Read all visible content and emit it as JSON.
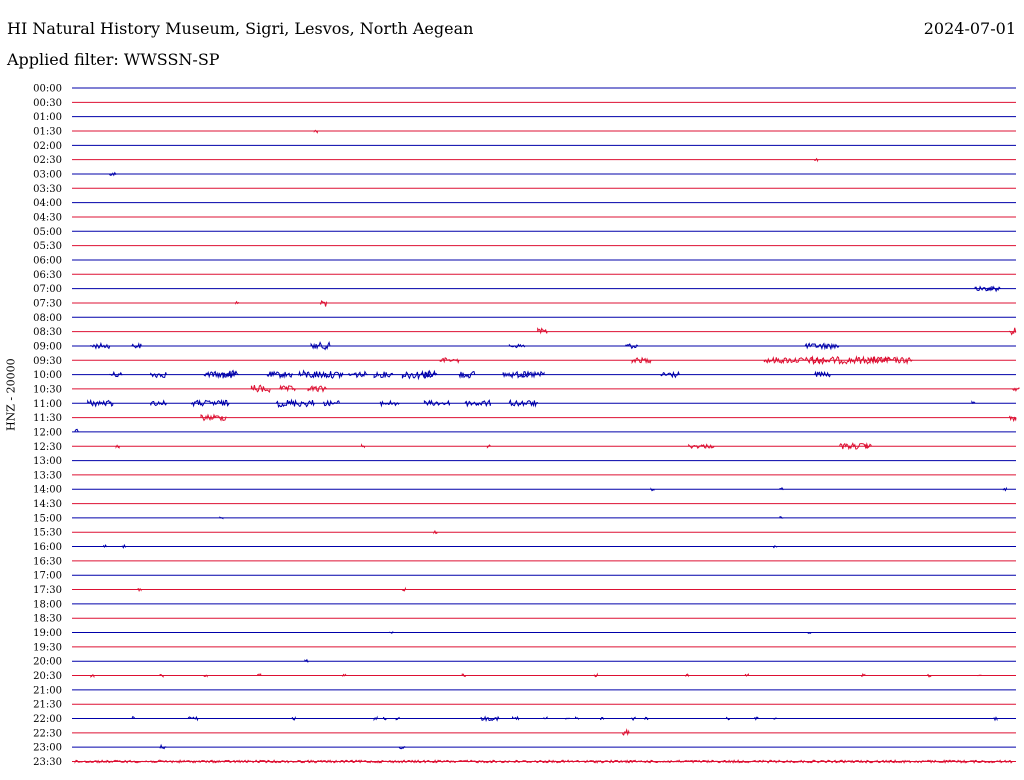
{
  "header": {
    "station": "HI Natural History Museum, Sigri, Lesvos, North Aegean",
    "date": "2024-07-01",
    "filter": "Applied filter: WWSSN-SP"
  },
  "chart_data": {
    "type": "line",
    "ylabel": "HNZ - 20000",
    "colors": {
      "even_trace": "#0000aa",
      "odd_trace": "#dd1133",
      "text": "#000000"
    },
    "tick_labels": [
      "00:00",
      "00:30",
      "01:00",
      "01:30",
      "02:00",
      "02:30",
      "03:00",
      "03:30",
      "04:00",
      "04:30",
      "05:00",
      "05:30",
      "06:00",
      "06:30",
      "07:00",
      "07:30",
      "08:00",
      "08:30",
      "09:00",
      "09:30",
      "10:00",
      "10:30",
      "11:00",
      "11:30",
      "12:00",
      "12:30",
      "13:00",
      "13:30",
      "14:00",
      "14:30",
      "15:00",
      "15:30",
      "16:00",
      "16:30",
      "17:00",
      "17:30",
      "18:00",
      "18:30",
      "19:00",
      "19:30",
      "20:00",
      "20:30",
      "21:00",
      "21:30",
      "22:00",
      "22:30",
      "23:00",
      "23:30"
    ],
    "x_range_minutes": [
      0,
      30
    ],
    "activity": [
      {
        "row": 1,
        "bursts": []
      },
      {
        "row": 3,
        "bursts": [
          [
            7.7,
            0.1,
            0.3
          ]
        ]
      },
      {
        "row": 5,
        "bursts": [
          [
            23.6,
            0.1,
            0.3
          ]
        ]
      },
      {
        "row": 6,
        "bursts": [
          [
            1.2,
            0.2,
            0.4
          ]
        ]
      },
      {
        "row": 14,
        "bursts": [
          [
            28.7,
            0.8,
            0.5
          ],
          [
            29.1,
            0.2,
            0.4
          ]
        ]
      },
      {
        "row": 15,
        "bursts": [
          [
            5.2,
            0.1,
            0.3
          ],
          [
            7.9,
            0.2,
            0.8
          ]
        ]
      },
      {
        "row": 17,
        "bursts": [
          [
            14.8,
            0.3,
            0.6
          ],
          [
            29.8,
            0.2,
            0.8
          ]
        ]
      },
      {
        "row": 18,
        "bursts": [
          [
            0.6,
            0.6,
            0.5
          ],
          [
            1.9,
            0.3,
            0.5
          ],
          [
            7.6,
            0.6,
            0.7
          ],
          [
            13.9,
            0.5,
            0.4
          ],
          [
            17.6,
            0.4,
            0.5
          ],
          [
            23.3,
            0.5,
            0.5
          ],
          [
            23.8,
            0.6,
            0.6
          ]
        ]
      },
      {
        "row": 19,
        "bursts": [
          [
            11.7,
            0.6,
            0.5
          ],
          [
            17.8,
            0.6,
            0.5
          ],
          [
            22.0,
            2.0,
            0.6
          ],
          [
            23.5,
            2.5,
            0.7
          ],
          [
            25.3,
            1.4,
            0.6
          ]
        ]
      },
      {
        "row": 20,
        "bursts": [
          [
            1.2,
            0.4,
            0.5
          ],
          [
            2.5,
            0.5,
            0.6
          ],
          [
            4.2,
            0.6,
            0.6
          ],
          [
            4.8,
            0.4,
            0.5
          ],
          [
            4.9,
            0.1,
            0.4
          ],
          [
            4.8,
            0.5,
            0.8
          ],
          [
            6.2,
            0.8,
            0.6
          ],
          [
            7.2,
            0.7,
            0.8
          ],
          [
            7.9,
            0.7,
            0.7
          ],
          [
            8.8,
            0.6,
            0.6
          ],
          [
            9.6,
            0.6,
            0.6
          ],
          [
            10.5,
            1.1,
            0.8
          ],
          [
            11.1,
            0.5,
            0.6
          ],
          [
            12.3,
            0.5,
            0.7
          ],
          [
            13.7,
            0.8,
            0.6
          ],
          [
            14.3,
            0.7,
            0.6
          ],
          [
            18.7,
            0.6,
            0.6
          ],
          [
            23.6,
            0.5,
            0.5
          ]
        ]
      },
      {
        "row": 21,
        "bursts": [
          [
            5.7,
            0.6,
            0.8
          ],
          [
            6.6,
            0.5,
            0.6
          ],
          [
            7.5,
            0.6,
            0.6
          ],
          [
            29.9,
            0.2,
            0.4
          ]
        ]
      },
      {
        "row": 22,
        "bursts": [
          [
            0.5,
            0.8,
            0.6
          ],
          [
            2.5,
            0.5,
            0.5
          ],
          [
            3.8,
            1.2,
            0.6
          ],
          [
            6.5,
            1.2,
            0.7
          ],
          [
            8.0,
            0.5,
            0.5
          ],
          [
            9.8,
            0.6,
            0.5
          ],
          [
            11.2,
            0.8,
            0.5
          ],
          [
            12.5,
            0.8,
            0.6
          ],
          [
            13.9,
            0.9,
            0.6
          ],
          [
            28.6,
            0.1,
            0.3
          ]
        ]
      },
      {
        "row": 23,
        "bursts": [
          [
            4.1,
            0.8,
            0.6
          ],
          [
            29.8,
            0.2,
            0.8
          ]
        ]
      },
      {
        "row": 24,
        "bursts": [
          [
            0.1,
            0.1,
            0.7
          ]
        ]
      },
      {
        "row": 25,
        "bursts": [
          [
            1.4,
            0.1,
            0.4
          ],
          [
            9.2,
            0.1,
            0.3
          ],
          [
            13.2,
            0.1,
            0.3
          ],
          [
            19.6,
            0.8,
            0.4
          ],
          [
            24.4,
            0.9,
            0.6
          ],
          [
            25.2,
            0.2,
            0.4
          ]
        ]
      },
      {
        "row": 28,
        "bursts": [
          [
            18.4,
            0.1,
            0.3
          ],
          [
            22.5,
            0.1,
            0.3
          ],
          [
            29.6,
            0.1,
            0.3
          ]
        ]
      },
      {
        "row": 30,
        "bursts": [
          [
            4.7,
            0.1,
            0.3
          ],
          [
            22.5,
            0.1,
            0.3
          ]
        ]
      },
      {
        "row": 31,
        "bursts": [
          [
            11.5,
            0.1,
            0.3
          ]
        ]
      },
      {
        "row": 32,
        "bursts": [
          [
            1.0,
            0.1,
            0.3
          ],
          [
            1.6,
            0.1,
            0.3
          ],
          [
            22.3,
            0.1,
            0.3
          ]
        ]
      },
      {
        "row": 35,
        "bursts": [
          [
            2.1,
            0.1,
            0.3
          ],
          [
            10.5,
            0.1,
            0.3
          ]
        ]
      },
      {
        "row": 38,
        "bursts": [
          [
            10.1,
            0.1,
            0.3
          ],
          [
            23.4,
            0.1,
            0.3
          ]
        ]
      },
      {
        "row": 40,
        "bursts": [
          [
            7.4,
            0.1,
            0.3
          ]
        ]
      },
      {
        "row": 41,
        "bursts": [
          [
            0.6,
            0.1,
            0.3
          ],
          [
            2.8,
            0.1,
            0.3
          ],
          [
            4.2,
            0.1,
            0.3
          ],
          [
            5.9,
            0.1,
            0.3
          ],
          [
            8.6,
            0.1,
            0.3
          ],
          [
            12.4,
            0.1,
            0.3
          ],
          [
            16.6,
            0.1,
            0.3
          ],
          [
            19.5,
            0.1,
            0.3
          ],
          [
            21.4,
            0.1,
            0.3
          ],
          [
            25.1,
            0.1,
            0.3
          ],
          [
            27.2,
            0.1,
            0.3
          ],
          [
            28.8,
            0.1,
            0.3
          ]
        ]
      },
      {
        "row": 44,
        "bursts": [
          [
            1.9,
            0.1,
            0.4
          ],
          [
            3.7,
            0.3,
            0.4
          ],
          [
            7.0,
            0.1,
            0.3
          ],
          [
            9.6,
            0.1,
            0.3
          ],
          [
            9.9,
            0.1,
            0.3
          ],
          [
            10.3,
            0.1,
            0.3
          ],
          [
            13.0,
            0.6,
            0.4
          ],
          [
            14.0,
            0.2,
            0.4
          ],
          [
            15.0,
            0.1,
            0.3
          ],
          [
            15.7,
            0.1,
            0.3
          ],
          [
            16.0,
            0.1,
            0.3
          ],
          [
            16.8,
            0.1,
            0.3
          ],
          [
            17.8,
            0.1,
            0.3
          ],
          [
            18.2,
            0.1,
            0.3
          ],
          [
            20.8,
            0.1,
            0.3
          ],
          [
            21.7,
            0.1,
            0.3
          ],
          [
            22.3,
            0.1,
            0.3
          ],
          [
            29.3,
            0.1,
            0.3
          ]
        ]
      },
      {
        "row": 45,
        "bursts": [
          [
            17.5,
            0.2,
            0.6
          ]
        ]
      },
      {
        "row": 46,
        "bursts": [
          [
            2.8,
            0.2,
            0.4
          ],
          [
            10.4,
            0.2,
            0.4
          ]
        ]
      },
      {
        "row": 47,
        "bursts": [
          [
            0.1,
            29.8,
            0.25
          ]
        ]
      }
    ]
  }
}
